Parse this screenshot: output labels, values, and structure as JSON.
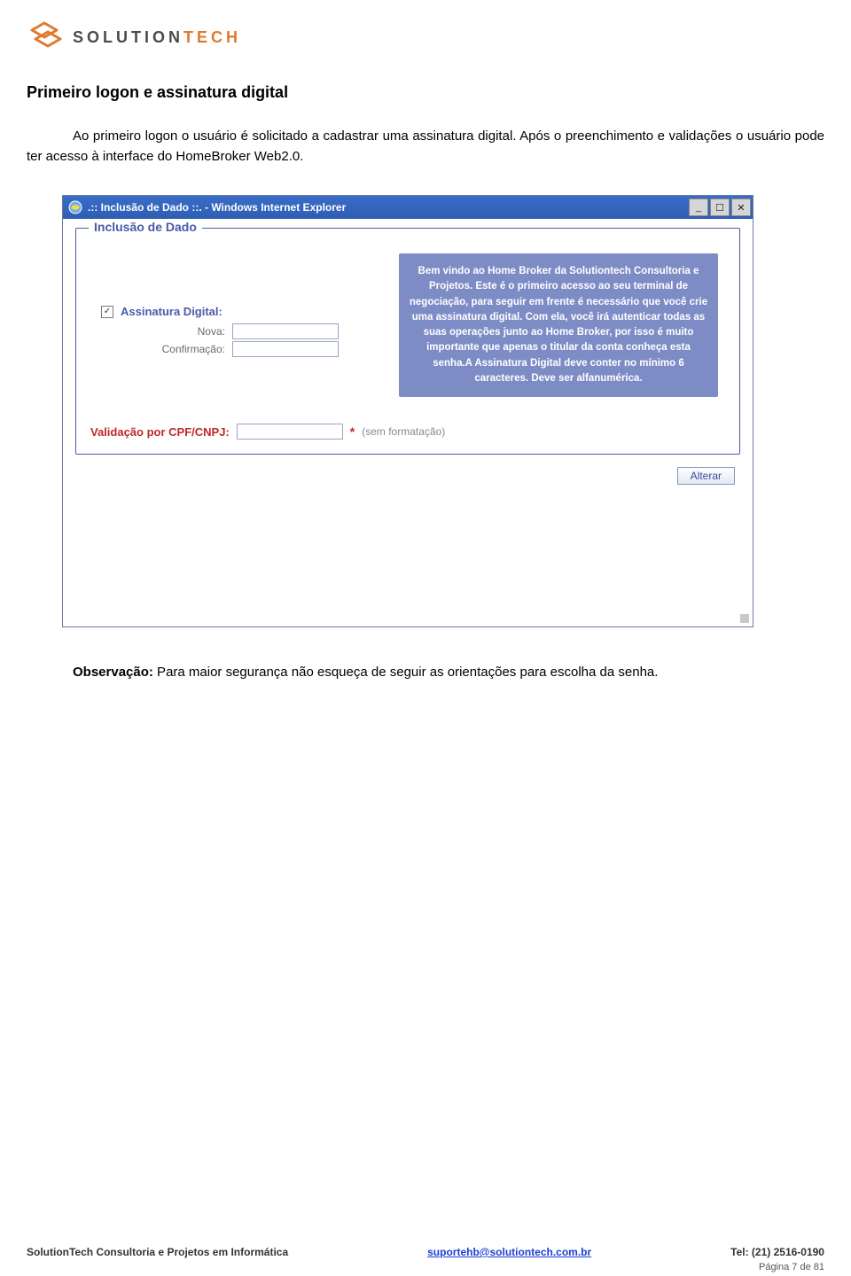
{
  "logo_text_1": "SOLUTION",
  "logo_text_2": "TECH",
  "heading": "Primeiro logon e assinatura digital",
  "intro": "Ao primeiro logon o usuário é solicitado a cadastrar uma assinatura digital. Após o preenchimento e validações o usuário pode ter acesso à interface do HomeBroker Web2.0.",
  "ie_title": ".:: Inclusão de Dado ::. - Windows Internet Explorer",
  "legend": "Inclusão de Dado",
  "checkbox_mark": "✓",
  "label_assinatura": "Assinatura Digital:",
  "label_nova": "Nova:",
  "label_confirm": "Confirmação:",
  "welcome_text": "Bem vindo ao Home Broker da Solutiontech Consultoria e Projetos. Este é o primeiro acesso ao seu terminal de negociação, para seguir em frente é necessário que você crie uma assinatura digital. Com ela, você irá autenticar todas as suas operações junto ao Home Broker, por isso é muito importante que apenas o titular da conta conheça esta senha.A Assinatura Digital deve conter no mínimo 6 caracteres. Deve ser alfanumérica.",
  "valid_label": "Validação por CPF/CNPJ:",
  "asterisk": "*",
  "hint": "(sem formatação)",
  "btn_alterar": "Alterar",
  "obs_label": "Observação:",
  "obs_text": " Para maior segurança não esqueça de seguir as orientações para escolha da senha.",
  "footer_company": "SolutionTech Consultoria e Projetos em Informática",
  "footer_email": "suportehb@solutiontech.com.br",
  "footer_phone": "Tel: (21) 2516-0190",
  "page_num": "Página 7 de 81"
}
